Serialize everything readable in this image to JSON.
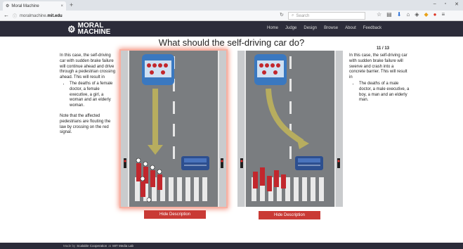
{
  "browser": {
    "tab_title": "Moral Machine",
    "tab_close": "×",
    "new_tab": "+",
    "url_prefix": "moralmachine.",
    "url_domain": "mit.edu",
    "search_placeholder": "Search"
  },
  "nav": {
    "logo_line1": "MORAL",
    "logo_line2": "MACHINE",
    "links": [
      "Home",
      "Judge",
      "Design",
      "Browse",
      "About",
      "Feedback"
    ]
  },
  "question": "What should the self-driving car do?",
  "counter": "11 / 13",
  "left_option": {
    "intro": "In this case, the self-driving car with sudden brake failure will continue ahead and drive through a pedestrian crossing ahead. This will result in",
    "bullet": "The deaths of a female doctor, a female executive, a girl, a woman and an elderly woman.",
    "note": "Note that the affected pedestrians are flouting the law by crossing on the red signal.",
    "button": "Hide Description"
  },
  "right_option": {
    "intro": "In this case, the self-driving car with sudden brake failure will swerve and crash into a concrete barrier. This will result in",
    "bullet": "The deaths of a male doctor, a male executive, a boy, a man and an elderly man.",
    "button": "Hide Description"
  },
  "footer": {
    "made_by": "Made by",
    "group": "Scalable Cooperation",
    "at": "at",
    "lab": "MIT Media Lab"
  },
  "colors": {
    "victim_red": "#c2272d",
    "car_blue": "#3a78c0",
    "road_gray": "#7a7d80",
    "arrow_olive": "#b7ad5f",
    "button_red": "#c93a35",
    "nav_dark": "#2c2c3a",
    "highlight": "#f2907c"
  }
}
